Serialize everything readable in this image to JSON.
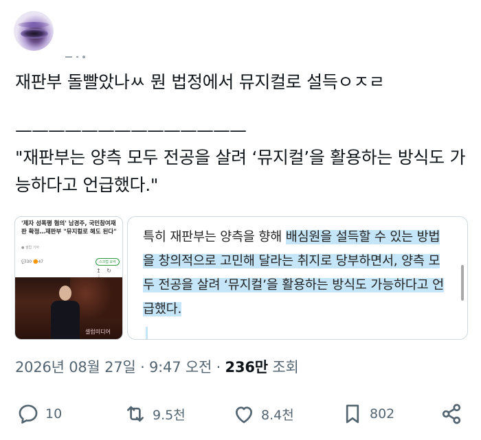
{
  "tweet": {
    "text": "재판부 돌빨았나ㅆ 뭔 법정에서 뮤지컬로 설득ㅇㅈㄹ",
    "divider": "——————————————",
    "quote": "\"재판부는 양측 모두 전공을 살려 ‘뮤지컬’을 활용하는 방식도 가능하다고 언급했다.\""
  },
  "card_left": {
    "headline": "'제자 성폭행 혐의' 남경주, 국민참여재판 확정…재판부 \"뮤지컬로 해도 된다\"",
    "byline": "● 셀럽 기자",
    "meta": "💬30  🟠47",
    "badge": "스크랩 요약",
    "icons": "↥ ↻ ⋮",
    "logo": "셀럽미디어"
  },
  "card_right": {
    "article_before": "특히 재판부는 양측을 향해 ",
    "article_highlight": "배심원을 설득할 수 있는 방법을 창의적으로 고민해 달라는 취지로 당부하면서, 양측 모두 전공을 살려 ‘뮤지컬’을 활용하는 방식도 가능하다고 언급했다."
  },
  "meta": {
    "date": "2026년 08월 27일 · 9:47 오전 · ",
    "views_count": "236만",
    "views_label": " 조회"
  },
  "actions": {
    "reply_count": "10",
    "retweet_count": "9.5천",
    "like_count": "8.4천",
    "bookmark_count": "802"
  },
  "colors": {
    "text": "#0f1419",
    "muted": "#536471",
    "highlight": "#c5e5f8",
    "border": "#cfd9de"
  }
}
